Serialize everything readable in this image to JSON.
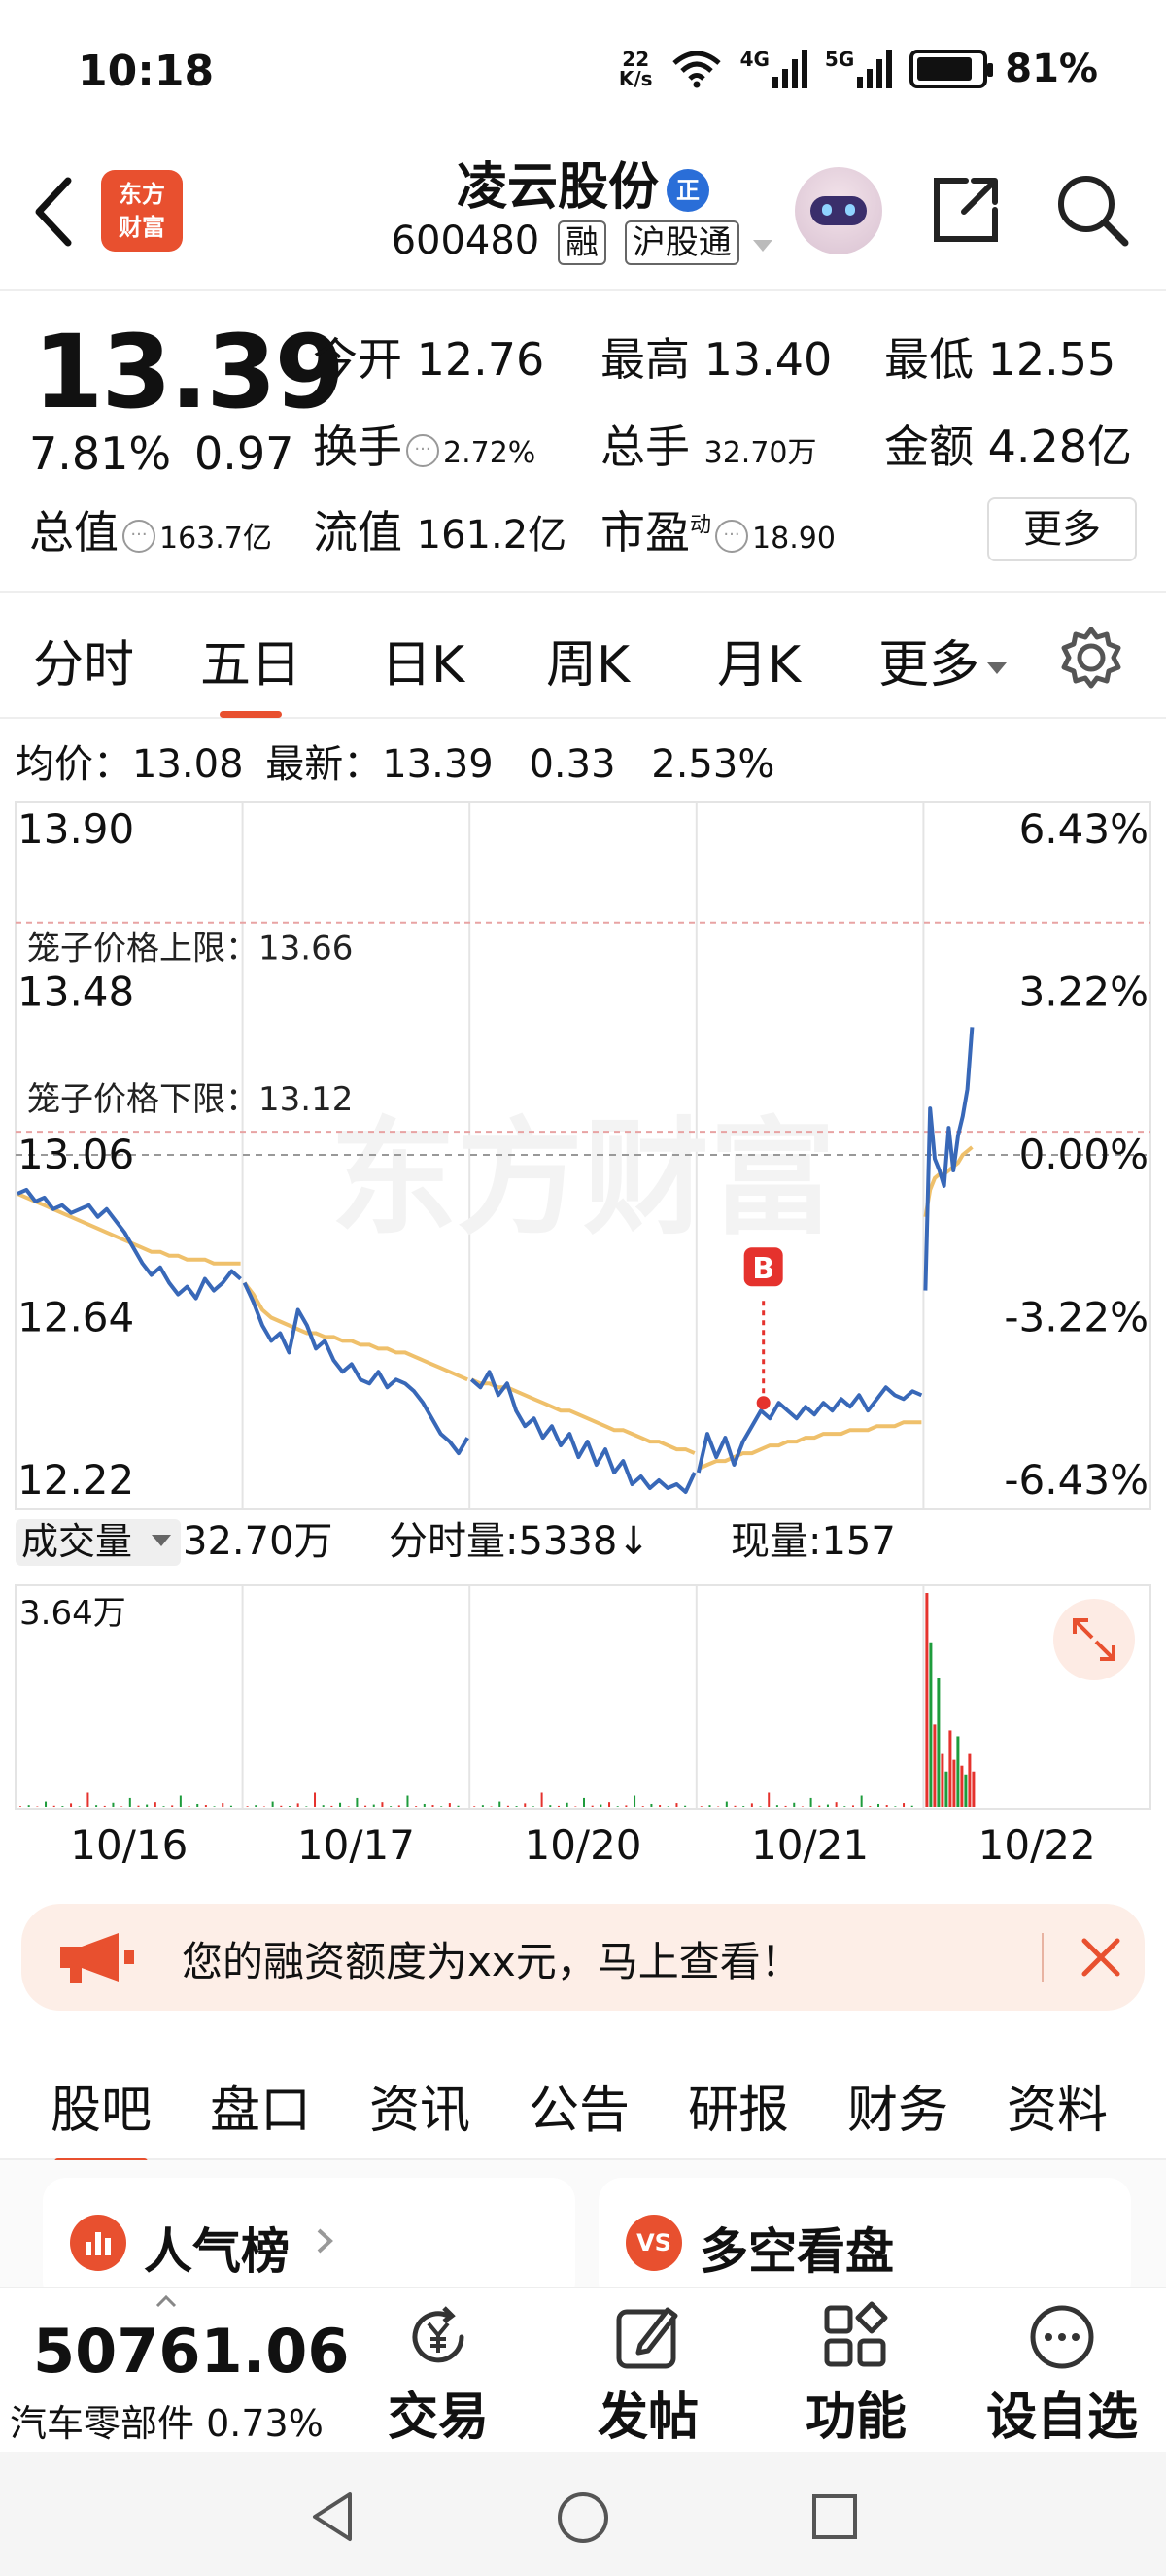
{
  "status_bar": {
    "time": "10:18",
    "speed_value": "22",
    "speed_unit": "K/s",
    "net1": "4G",
    "net2": "5G",
    "battery": "81%"
  },
  "header": {
    "logo_line1": "东方",
    "logo_line2": "财富",
    "stock_name": "凌云股份",
    "name_badge": "正",
    "code": "600480",
    "tag1": "融",
    "tag2": "沪股通"
  },
  "quote": {
    "price": "13.39",
    "change_pct": "7.81%",
    "change_amt": "0.97",
    "open_label": "今开",
    "open": "12.76",
    "high_label": "最高",
    "high": "13.40",
    "low_label": "最低",
    "low": "12.55",
    "turnover_label": "换手",
    "turnover": "2.72%",
    "volume_label": "总手",
    "volume": "32.70万",
    "amount_label": "金额",
    "amount": "4.28亿",
    "mcap_label": "总值",
    "mcap": "163.7亿",
    "float_label": "流值",
    "float": "161.2亿",
    "pe_label": "市盈",
    "pe_sup": "动",
    "pe": "18.90",
    "more_button": "更多"
  },
  "chart_tabs": [
    "分时",
    "五日",
    "日K",
    "周K",
    "月K",
    "更多"
  ],
  "chart_tab_active": 1,
  "avg_line": {
    "avg_label": "均价：",
    "avg": "13.08",
    "latest_label": "最新：",
    "latest": "13.39",
    "chg": "0.33",
    "chg_pct": "2.53%"
  },
  "chart_data": {
    "type": "line",
    "y_left_ticks": [
      "13.90",
      "13.48",
      "13.06",
      "12.64",
      "12.22"
    ],
    "y_right_ticks": [
      "6.43%",
      "3.22%",
      "0.00%",
      "-3.22%",
      "-6.43%"
    ],
    "ylim": [
      12.22,
      13.9
    ],
    "upper_limit_label": "笼子价格上限：13.66",
    "upper_limit": 13.66,
    "lower_limit_label": "笼子价格下限：13.12",
    "lower_limit": 13.12,
    "prev_close": 13.06,
    "x_labels": [
      "10/16",
      "10/17",
      "10/20",
      "10/21",
      "10/22"
    ],
    "watermark": "东方财富",
    "marker": {
      "text": "B",
      "day": 3,
      "frac": 0.3,
      "price": 12.42
    },
    "days": [
      {
        "price": [
          12.96,
          12.97,
          12.94,
          12.95,
          12.92,
          12.93,
          12.91,
          12.92,
          12.93,
          12.9,
          12.92,
          12.89,
          12.86,
          12.82,
          12.78,
          12.75,
          12.77,
          12.73,
          12.7,
          12.72,
          12.69,
          12.74,
          12.71,
          12.73,
          12.76,
          12.74
        ],
        "avg": [
          12.96,
          12.95,
          12.94,
          12.93,
          12.92,
          12.91,
          12.9,
          12.89,
          12.88,
          12.87,
          12.86,
          12.85,
          12.84,
          12.83,
          12.82,
          12.81,
          12.81,
          12.8,
          12.8,
          12.79,
          12.79,
          12.79,
          12.78,
          12.78,
          12.78,
          12.78
        ]
      },
      {
        "price": [
          12.73,
          12.68,
          12.62,
          12.58,
          12.6,
          12.55,
          12.66,
          12.62,
          12.56,
          12.58,
          12.53,
          12.5,
          12.52,
          12.48,
          12.47,
          12.5,
          12.46,
          12.48,
          12.47,
          12.45,
          12.42,
          12.38,
          12.34,
          12.32,
          12.29,
          12.33
        ],
        "avg": [
          12.73,
          12.7,
          12.66,
          12.64,
          12.63,
          12.62,
          12.61,
          12.6,
          12.6,
          12.59,
          12.59,
          12.58,
          12.58,
          12.57,
          12.57,
          12.56,
          12.56,
          12.55,
          12.55,
          12.54,
          12.53,
          12.52,
          12.51,
          12.5,
          12.49,
          12.48
        ]
      },
      {
        "price": [
          12.48,
          12.46,
          12.5,
          12.44,
          12.47,
          12.4,
          12.36,
          12.38,
          12.33,
          12.36,
          12.31,
          12.34,
          12.28,
          12.32,
          12.26,
          12.3,
          12.24,
          12.27,
          12.21,
          12.23,
          12.2,
          12.22,
          12.2,
          12.21,
          12.19,
          12.24
        ],
        "avg": [
          12.48,
          12.47,
          12.47,
          12.46,
          12.46,
          12.45,
          12.44,
          12.43,
          12.42,
          12.41,
          12.4,
          12.4,
          12.39,
          12.38,
          12.37,
          12.36,
          12.35,
          12.35,
          12.34,
          12.33,
          12.32,
          12.32,
          12.31,
          12.3,
          12.3,
          12.29
        ]
      },
      {
        "price": [
          12.24,
          12.34,
          12.28,
          12.33,
          12.26,
          12.32,
          12.36,
          12.4,
          12.38,
          12.42,
          12.4,
          12.38,
          12.41,
          12.39,
          12.42,
          12.4,
          12.43,
          12.41,
          12.44,
          12.4,
          12.43,
          12.46,
          12.44,
          12.43,
          12.45,
          12.44
        ],
        "avg": [
          12.25,
          12.26,
          12.27,
          12.27,
          12.28,
          12.29,
          12.29,
          12.3,
          12.31,
          12.31,
          12.32,
          12.32,
          12.33,
          12.33,
          12.34,
          12.34,
          12.34,
          12.35,
          12.35,
          12.35,
          12.36,
          12.36,
          12.36,
          12.37,
          12.37,
          12.37
        ]
      },
      {
        "price": [
          12.71,
          13.18,
          13.05,
          13.02,
          12.98,
          13.13,
          13.02,
          13.11,
          13.16,
          13.23,
          13.39
        ],
        "avg": [
          12.9,
          12.97,
          13.0,
          13.01,
          13.01,
          13.02,
          13.03,
          13.04,
          13.06,
          13.07,
          13.08
        ]
      }
    ],
    "volume": {
      "title": "成交量",
      "total": "32.70万",
      "bar_vol_label": "分时量:5338↓",
      "current_label": "现量:157",
      "ymax_label": "3.64万",
      "ymax": 36400,
      "day4_bars": [
        36400,
        28000,
        14000,
        22000,
        9000,
        6000,
        13000,
        8000,
        12000,
        7000,
        5500,
        9000,
        6000
      ],
      "day4_colors": [
        "up",
        "down",
        "up",
        "down",
        "up",
        "down",
        "up",
        "up",
        "down",
        "up",
        "down",
        "up",
        "up"
      ],
      "other_bars": [
        120,
        300,
        80,
        900,
        200,
        150,
        600,
        100,
        2400,
        300,
        180,
        700,
        90,
        1500,
        220,
        400,
        800,
        130,
        260,
        1900,
        140,
        500,
        320,
        110,
        650,
        210
      ]
    }
  },
  "colors": {
    "up": "#e5322d",
    "down": "#1e9c3c",
    "price_line": "#3868b8",
    "avg_line": "#efc06b",
    "accent": "#e8502f"
  },
  "banner": {
    "text": "您的融资额度为xx元，马上查看！"
  },
  "bottom_tabs": [
    "股吧",
    "盘口",
    "资讯",
    "公告",
    "研报",
    "财务",
    "资料"
  ],
  "bottom_tab_active": 0,
  "cards": [
    {
      "icon": "bar-chart-icon",
      "title": "人气榜"
    },
    {
      "icon": "vs-icon",
      "title": "多空看盘"
    }
  ],
  "index_bar": {
    "value": "50761.06",
    "label": "汽车零部件 0.73%"
  },
  "actions": [
    {
      "label": "交易"
    },
    {
      "label": "发帖"
    },
    {
      "label": "功能"
    },
    {
      "label": "设自选"
    }
  ]
}
